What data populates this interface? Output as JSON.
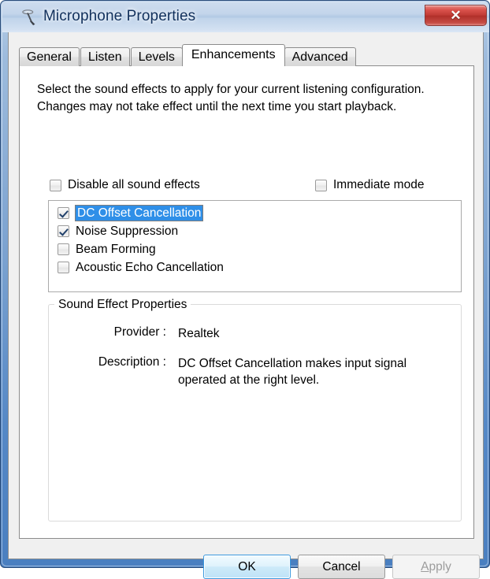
{
  "window": {
    "title": "Microphone Properties",
    "icon": "microphone-icon",
    "close_label": "✕"
  },
  "tabs": [
    {
      "label": "General",
      "selected": false
    },
    {
      "label": "Listen",
      "selected": false
    },
    {
      "label": "Levels",
      "selected": false
    },
    {
      "label": "Enhancements",
      "selected": true
    },
    {
      "label": "Advanced",
      "selected": false
    }
  ],
  "content": {
    "intro_line1": "Select the sound effects to apply for your current listening configuration.",
    "intro_line2": "Changes may not take effect until the next time you start playback.",
    "disable_all_label": "Disable all sound effects",
    "disable_all_checked": false,
    "immediate_mode_label": "Immediate mode",
    "immediate_mode_checked": false,
    "effects": [
      {
        "label": "DC Offset Cancellation",
        "checked": true,
        "selected": true
      },
      {
        "label": "Noise Suppression",
        "checked": true,
        "selected": false
      },
      {
        "label": "Beam Forming",
        "checked": false,
        "selected": false
      },
      {
        "label": "Acoustic Echo Cancellation",
        "checked": false,
        "selected": false
      }
    ],
    "group": {
      "title": "Sound Effect Properties",
      "provider_label": "Provider :",
      "provider_value": "Realtek",
      "description_label": "Description :",
      "description_value": "DC Offset Cancellation makes input signal operated at the right level."
    }
  },
  "buttons": {
    "ok": "OK",
    "cancel": "Cancel",
    "apply_accel": "A",
    "apply_rest": "pply",
    "apply_enabled": false
  },
  "colors": {
    "selection_blue": "#2f8fe8",
    "title_text": "#11305c",
    "frame_blue": "#5588c6",
    "close_red": "#c03a34"
  }
}
